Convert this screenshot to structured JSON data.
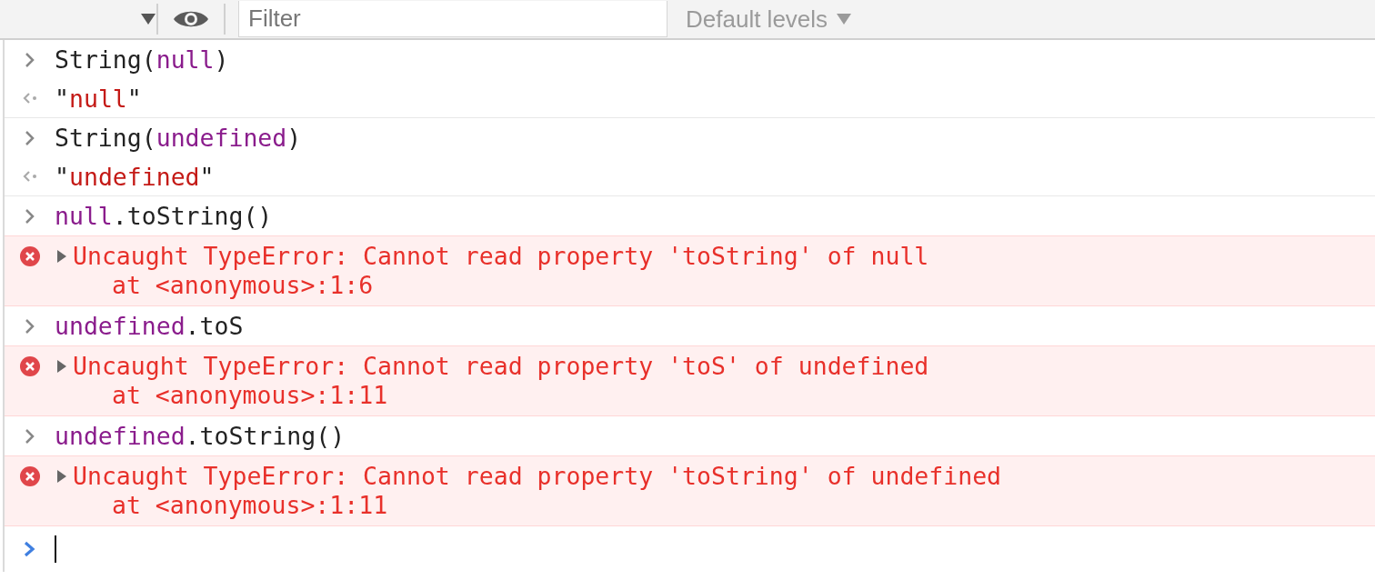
{
  "toolbar": {
    "filter": {
      "placeholder": "Filter"
    },
    "levels": {
      "label": "Default levels"
    }
  },
  "entries": [
    {
      "kind": "input",
      "tokens": [
        {
          "text": "String(",
          "kind": "plain"
        },
        {
          "text": "null",
          "kind": "keyword"
        },
        {
          "text": ")",
          "kind": "plain"
        }
      ]
    },
    {
      "kind": "output",
      "tokens": [
        {
          "text": "\"",
          "kind": "plain"
        },
        {
          "text": "null",
          "kind": "string"
        },
        {
          "text": "\"",
          "kind": "plain"
        }
      ]
    },
    {
      "kind": "input",
      "tokens": [
        {
          "text": "String(",
          "kind": "plain"
        },
        {
          "text": "undefined",
          "kind": "keyword"
        },
        {
          "text": ")",
          "kind": "plain"
        }
      ]
    },
    {
      "kind": "output",
      "tokens": [
        {
          "text": "\"",
          "kind": "plain"
        },
        {
          "text": "undefined",
          "kind": "string"
        },
        {
          "text": "\"",
          "kind": "plain"
        }
      ]
    },
    {
      "kind": "input",
      "tokens": [
        {
          "text": "null",
          "kind": "keyword"
        },
        {
          "text": ".toString()",
          "kind": "plain"
        }
      ]
    },
    {
      "kind": "error",
      "expanded": false,
      "message": "Uncaught TypeError: Cannot read property 'toString' of null",
      "location": "at <anonymous>:1:6"
    },
    {
      "kind": "input",
      "tokens": [
        {
          "text": "undefined",
          "kind": "keyword"
        },
        {
          "text": ".toS",
          "kind": "plain"
        }
      ]
    },
    {
      "kind": "error",
      "expanded": false,
      "message": "Uncaught TypeError: Cannot read property 'toS' of undefined",
      "location": "at <anonymous>:1:11"
    },
    {
      "kind": "input",
      "tokens": [
        {
          "text": "undefined",
          "kind": "keyword"
        },
        {
          "text": ".toString()",
          "kind": "plain"
        }
      ]
    },
    {
      "kind": "error",
      "expanded": false,
      "message": "Uncaught TypeError: Cannot read property 'toString' of undefined",
      "location": "at <anonymous>:1:11"
    },
    {
      "kind": "prompt"
    }
  ]
}
